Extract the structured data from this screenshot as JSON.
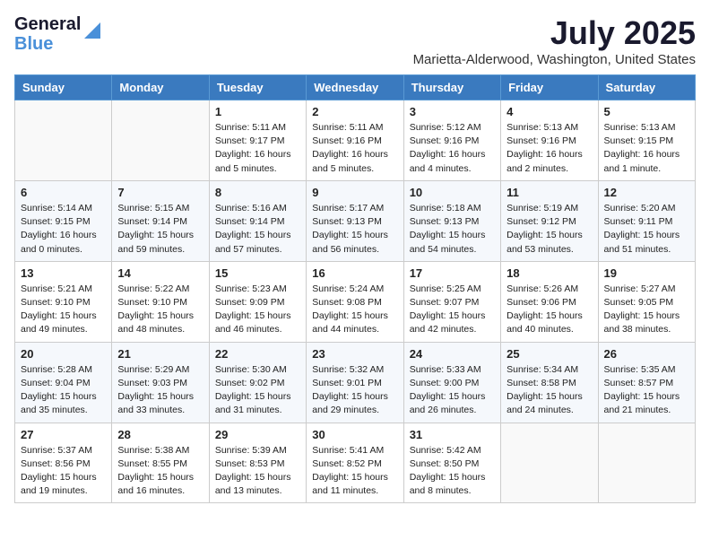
{
  "header": {
    "logo_general": "General",
    "logo_blue": "Blue",
    "month": "July 2025",
    "location": "Marietta-Alderwood, Washington, United States"
  },
  "weekdays": [
    "Sunday",
    "Monday",
    "Tuesday",
    "Wednesday",
    "Thursday",
    "Friday",
    "Saturday"
  ],
  "weeks": [
    [
      {
        "day": "",
        "info": ""
      },
      {
        "day": "",
        "info": ""
      },
      {
        "day": "1",
        "info": "Sunrise: 5:11 AM\nSunset: 9:17 PM\nDaylight: 16 hours and 5 minutes."
      },
      {
        "day": "2",
        "info": "Sunrise: 5:11 AM\nSunset: 9:16 PM\nDaylight: 16 hours and 5 minutes."
      },
      {
        "day": "3",
        "info": "Sunrise: 5:12 AM\nSunset: 9:16 PM\nDaylight: 16 hours and 4 minutes."
      },
      {
        "day": "4",
        "info": "Sunrise: 5:13 AM\nSunset: 9:16 PM\nDaylight: 16 hours and 2 minutes."
      },
      {
        "day": "5",
        "info": "Sunrise: 5:13 AM\nSunset: 9:15 PM\nDaylight: 16 hours and 1 minute."
      }
    ],
    [
      {
        "day": "6",
        "info": "Sunrise: 5:14 AM\nSunset: 9:15 PM\nDaylight: 16 hours and 0 minutes."
      },
      {
        "day": "7",
        "info": "Sunrise: 5:15 AM\nSunset: 9:14 PM\nDaylight: 15 hours and 59 minutes."
      },
      {
        "day": "8",
        "info": "Sunrise: 5:16 AM\nSunset: 9:14 PM\nDaylight: 15 hours and 57 minutes."
      },
      {
        "day": "9",
        "info": "Sunrise: 5:17 AM\nSunset: 9:13 PM\nDaylight: 15 hours and 56 minutes."
      },
      {
        "day": "10",
        "info": "Sunrise: 5:18 AM\nSunset: 9:13 PM\nDaylight: 15 hours and 54 minutes."
      },
      {
        "day": "11",
        "info": "Sunrise: 5:19 AM\nSunset: 9:12 PM\nDaylight: 15 hours and 53 minutes."
      },
      {
        "day": "12",
        "info": "Sunrise: 5:20 AM\nSunset: 9:11 PM\nDaylight: 15 hours and 51 minutes."
      }
    ],
    [
      {
        "day": "13",
        "info": "Sunrise: 5:21 AM\nSunset: 9:10 PM\nDaylight: 15 hours and 49 minutes."
      },
      {
        "day": "14",
        "info": "Sunrise: 5:22 AM\nSunset: 9:10 PM\nDaylight: 15 hours and 48 minutes."
      },
      {
        "day": "15",
        "info": "Sunrise: 5:23 AM\nSunset: 9:09 PM\nDaylight: 15 hours and 46 minutes."
      },
      {
        "day": "16",
        "info": "Sunrise: 5:24 AM\nSunset: 9:08 PM\nDaylight: 15 hours and 44 minutes."
      },
      {
        "day": "17",
        "info": "Sunrise: 5:25 AM\nSunset: 9:07 PM\nDaylight: 15 hours and 42 minutes."
      },
      {
        "day": "18",
        "info": "Sunrise: 5:26 AM\nSunset: 9:06 PM\nDaylight: 15 hours and 40 minutes."
      },
      {
        "day": "19",
        "info": "Sunrise: 5:27 AM\nSunset: 9:05 PM\nDaylight: 15 hours and 38 minutes."
      }
    ],
    [
      {
        "day": "20",
        "info": "Sunrise: 5:28 AM\nSunset: 9:04 PM\nDaylight: 15 hours and 35 minutes."
      },
      {
        "day": "21",
        "info": "Sunrise: 5:29 AM\nSunset: 9:03 PM\nDaylight: 15 hours and 33 minutes."
      },
      {
        "day": "22",
        "info": "Sunrise: 5:30 AM\nSunset: 9:02 PM\nDaylight: 15 hours and 31 minutes."
      },
      {
        "day": "23",
        "info": "Sunrise: 5:32 AM\nSunset: 9:01 PM\nDaylight: 15 hours and 29 minutes."
      },
      {
        "day": "24",
        "info": "Sunrise: 5:33 AM\nSunset: 9:00 PM\nDaylight: 15 hours and 26 minutes."
      },
      {
        "day": "25",
        "info": "Sunrise: 5:34 AM\nSunset: 8:58 PM\nDaylight: 15 hours and 24 minutes."
      },
      {
        "day": "26",
        "info": "Sunrise: 5:35 AM\nSunset: 8:57 PM\nDaylight: 15 hours and 21 minutes."
      }
    ],
    [
      {
        "day": "27",
        "info": "Sunrise: 5:37 AM\nSunset: 8:56 PM\nDaylight: 15 hours and 19 minutes."
      },
      {
        "day": "28",
        "info": "Sunrise: 5:38 AM\nSunset: 8:55 PM\nDaylight: 15 hours and 16 minutes."
      },
      {
        "day": "29",
        "info": "Sunrise: 5:39 AM\nSunset: 8:53 PM\nDaylight: 15 hours and 13 minutes."
      },
      {
        "day": "30",
        "info": "Sunrise: 5:41 AM\nSunset: 8:52 PM\nDaylight: 15 hours and 11 minutes."
      },
      {
        "day": "31",
        "info": "Sunrise: 5:42 AM\nSunset: 8:50 PM\nDaylight: 15 hours and 8 minutes."
      },
      {
        "day": "",
        "info": ""
      },
      {
        "day": "",
        "info": ""
      }
    ]
  ]
}
